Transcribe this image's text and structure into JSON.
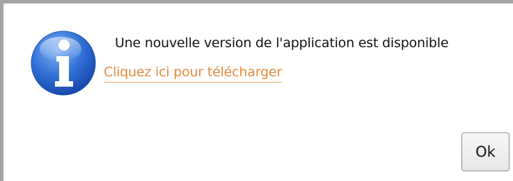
{
  "dialog": {
    "icon": "info-icon",
    "message": "Une nouvelle version de l'application est disponible",
    "link_label": "Cliquez ici pour télécharger",
    "ok_label": "Ok"
  },
  "colors": {
    "link": "#e58a3c",
    "icon_blue": "#2f6fd6",
    "frame": "#a4a4a4"
  }
}
